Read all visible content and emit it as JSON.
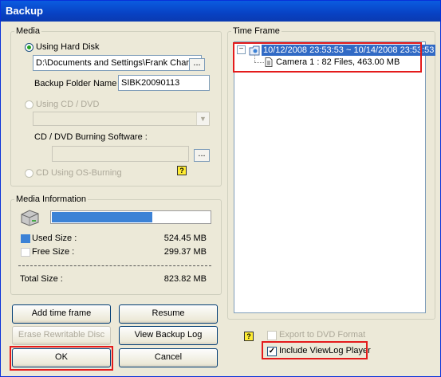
{
  "window": {
    "title": "Backup"
  },
  "media": {
    "legend": "Media",
    "hard_disk_label": "Using Hard Disk",
    "path_value": "D:\\Documents and Settings\\Frank Chang\\",
    "browse_label": "...",
    "folder_label": "Backup Folder Name :",
    "folder_value": "SIBK20090113",
    "cd_dvd_label": "Using CD / DVD",
    "burning_label": "CD / DVD Burning Software :",
    "browse2_label": "...",
    "os_burning_label": "CD Using OS-Burning",
    "help_glyph": "?"
  },
  "media_info": {
    "legend": "Media Information",
    "used_fraction": 0.64,
    "used_label": "Used Size :",
    "used_value": "524.45 MB",
    "free_label": "Free Size :",
    "free_value": "299.37 MB",
    "total_label": "Total Size :",
    "total_value": "823.82 MB",
    "used_color": "#3c82d6",
    "free_color": "#ffffff"
  },
  "buttons": {
    "add_time_frame": "Add time frame",
    "resume": "Resume",
    "erase": "Erase Rewritable Disc",
    "view_log": "View Backup Log",
    "ok": "OK",
    "cancel": "Cancel"
  },
  "time_frame": {
    "legend": "Time Frame",
    "expander": "⊟",
    "range": "10/12/2008 23:53:53 ~ 10/14/2008 23:53:53",
    "camera_entry": "Camera 1 : 82 Files, 463.00 MB"
  },
  "options": {
    "help_glyph": "?",
    "export_dvd_label": "Export to DVD Format",
    "include_player_label": "Include ViewLog Player",
    "check_glyph": "✓"
  },
  "highlight_color": "#e41b1b"
}
